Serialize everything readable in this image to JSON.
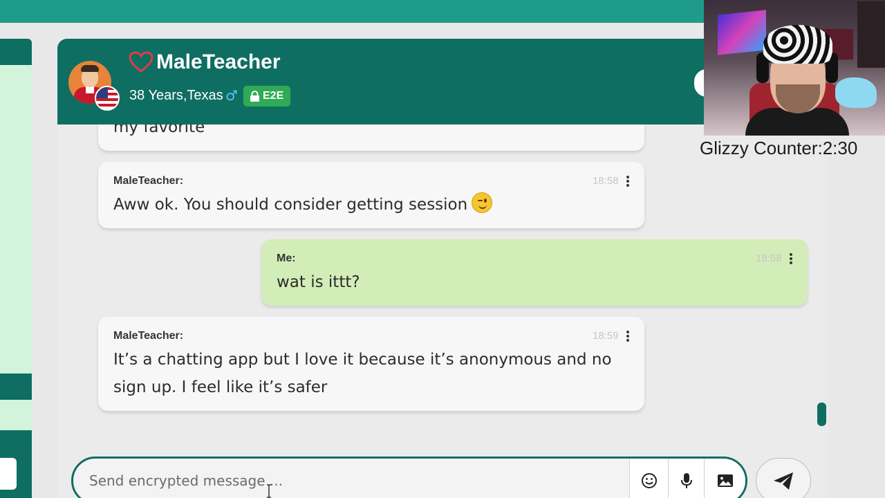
{
  "header": {
    "name": "MaleTeacher",
    "meta": "38 Years,Texas",
    "gender_symbol": "♂",
    "badge": "E2E"
  },
  "messages": [
    {
      "sender": "",
      "time": "",
      "text": "my favorite",
      "direction": "in"
    },
    {
      "sender": "MaleTeacher:",
      "time": "18:58",
      "text": "Aww ok. You should consider getting session",
      "direction": "in",
      "emoji": "wink-icon"
    },
    {
      "sender": "Me:",
      "time": "18:58",
      "text": "wat is ittt?",
      "direction": "out"
    },
    {
      "sender": "MaleTeacher:",
      "time": "18:59",
      "text": "It’s a chatting app but I love it because it’s anonymous and no sign up. I feel like it’s safer",
      "direction": "in"
    }
  ],
  "composer": {
    "placeholder": "Send encrypted message ..."
  },
  "overlay": {
    "counter": "Glizzy Counter:2:30"
  },
  "colors": {
    "header": "#0f6e62",
    "topbar": "#1e9b8b",
    "incoming_bubble": "#f7f7f7",
    "outgoing_bubble": "#d3edb8",
    "badge": "#2faa55",
    "heart": "#e03a4a"
  },
  "icons": [
    "heart-icon",
    "male-icon",
    "lock-icon",
    "more-icon",
    "wink-icon",
    "emoji-icon",
    "microphone-icon",
    "image-icon",
    "send-icon"
  ]
}
